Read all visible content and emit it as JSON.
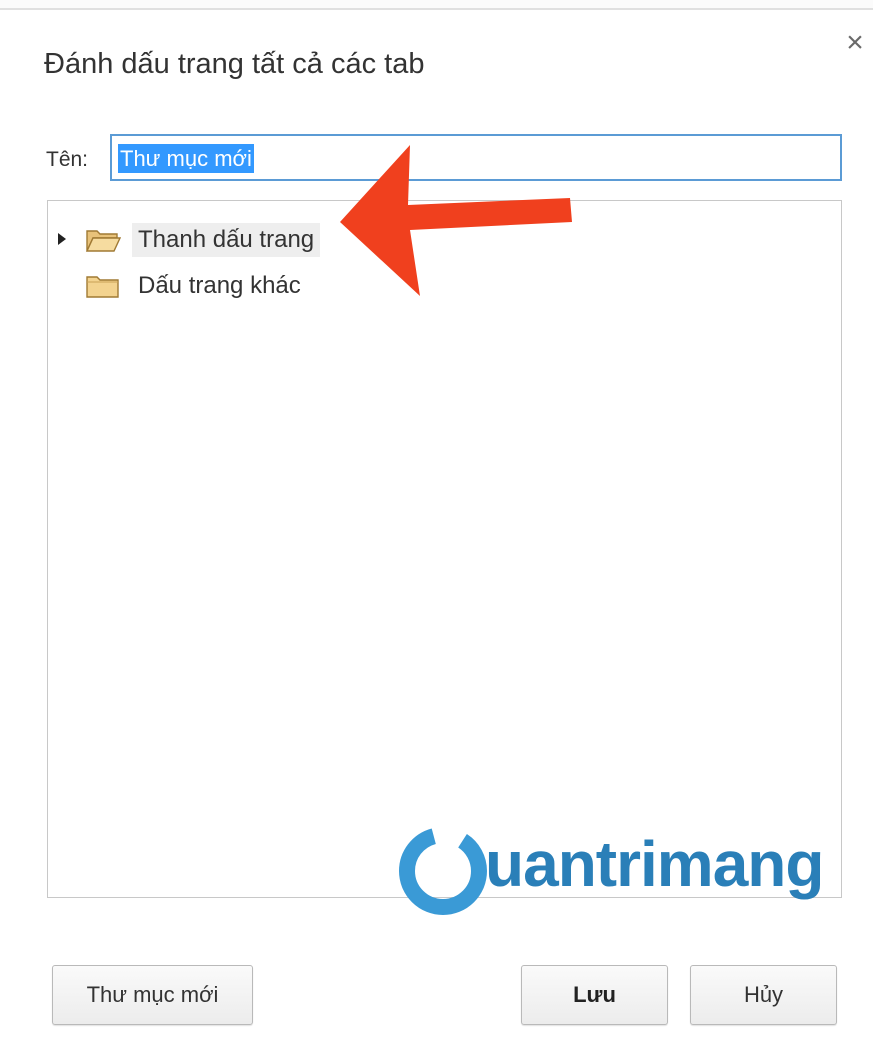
{
  "dialog": {
    "title": "Đánh dấu trang tất cả các tab",
    "close_icon": "close-icon"
  },
  "name_field": {
    "label": "Tên:",
    "value": "Thư mục mới"
  },
  "folder_tree": {
    "items": [
      {
        "label": "Thanh dấu trang",
        "expandable": true,
        "selected": true,
        "icon": "folder-open-icon"
      },
      {
        "label": "Dấu trang khác",
        "expandable": false,
        "selected": false,
        "icon": "folder-icon"
      }
    ]
  },
  "watermark": {
    "text": "uantrimang"
  },
  "buttons": {
    "new_folder": "Thư mục mới",
    "save": "Lưu",
    "cancel": "Hủy"
  },
  "colors": {
    "input_border": "#5b9bd5",
    "selection": "#3399ff",
    "annotation_arrow": "#f0401e",
    "watermark": "#2a7fb8"
  }
}
